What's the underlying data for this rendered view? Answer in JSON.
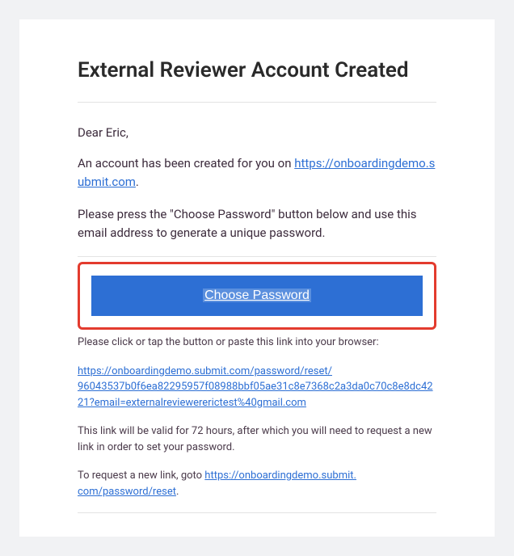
{
  "title": "External Reviewer Account Created",
  "greeting": "Dear Eric,",
  "intro": {
    "prefix": "An account has been created for you on ",
    "link_text": "https://onboardingdemo.submit.com",
    "suffix": "."
  },
  "instruction": "Please press the \"Choose Password\" button below and use this email address to generate a unique password.",
  "button_label": "Choose Password",
  "alt_instruction": "Please click or tap the button or paste this link into your browser:",
  "reset_link_line1": "https://onboardingdemo.submit.com/password/reset/",
  "reset_link_line2": "96043537b0f6ea82295957f08988bbf05ae31c8e7368c2a3da0c70c8e8dc4221?email=externalreviewererictest%40gmail.com",
  "validity": "This link will be valid for 72 hours, after which you will need to request a new link in order to set your password.",
  "request_new": {
    "prefix": "To request a new link, goto ",
    "link_line1": "https://onboardingdemo.submit.",
    "link_line2": "com/password/reset",
    "suffix": "."
  }
}
